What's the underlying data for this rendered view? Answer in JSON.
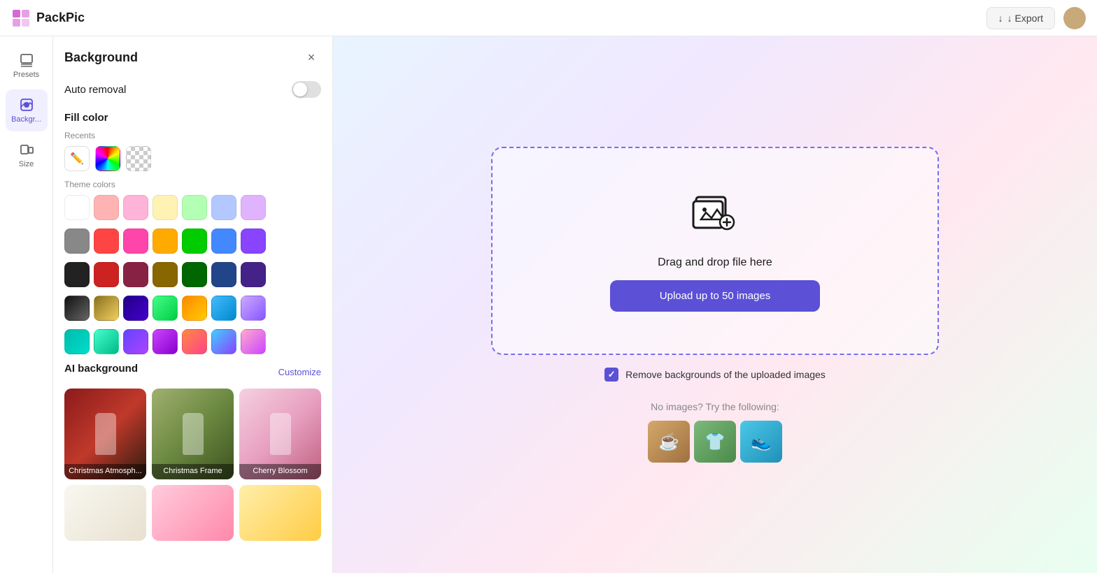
{
  "app": {
    "name": "PackPic",
    "logo_icon": "grid-icon"
  },
  "topbar": {
    "export_label": "↓ Export",
    "avatar_alt": "user-avatar"
  },
  "sidebar": {
    "items": [
      {
        "id": "presets",
        "label": "Presets",
        "icon": "layers-icon",
        "active": false
      },
      {
        "id": "background",
        "label": "Backgr...",
        "icon": "background-icon",
        "active": true
      },
      {
        "id": "size",
        "label": "Size",
        "icon": "size-icon",
        "active": false
      }
    ]
  },
  "panel": {
    "title": "Background",
    "close_label": "×",
    "auto_removal": {
      "label": "Auto removal",
      "enabled": false
    },
    "fill_color": {
      "title": "Fill color",
      "recents_label": "Recents",
      "theme_colors_label": "Theme colors",
      "recents": [
        {
          "type": "pen",
          "value": "pen"
        },
        {
          "type": "multicolor",
          "value": "multicolor"
        },
        {
          "type": "checker",
          "value": "checker"
        }
      ],
      "theme_colors_row1": [
        "#ffffff",
        "#ffb3b3",
        "#ffb3d9",
        "#fff3b3",
        "#b3ffb3",
        "#b3c8ff",
        "#e0b3ff"
      ],
      "theme_colors_row2": [
        "#888888",
        "#ff4444",
        "#ff44aa",
        "#ffaa00",
        "#00cc00",
        "#4488ff",
        "#8844ff"
      ],
      "theme_colors_row3": [
        "#222222",
        "#cc2222",
        "#882244",
        "#886600",
        "#006600",
        "#224488",
        "#442288"
      ],
      "gradient_row1": [
        {
          "type": "gradient",
          "style": "linear-gradient(135deg, #111 0%, #666 100%)"
        },
        {
          "type": "gradient",
          "style": "linear-gradient(135deg, #8b7020 0%, #f0d060 100%)"
        },
        {
          "type": "gradient",
          "style": "linear-gradient(135deg, #220088 0%, #4400cc 100%)"
        },
        {
          "type": "gradient",
          "style": "linear-gradient(135deg, #44ff88 0%, #00cc44 100%)"
        },
        {
          "type": "gradient",
          "style": "linear-gradient(135deg, #ff8800 0%, #ffcc00 100%)"
        },
        {
          "type": "gradient",
          "style": "linear-gradient(135deg, #44bbff 0%, #0088cc 100%)"
        },
        {
          "type": "gradient",
          "style": "linear-gradient(135deg, #ccaaff 0%, #8855ff 100%)"
        }
      ],
      "gradient_row2": [
        {
          "type": "gradient",
          "style": "linear-gradient(135deg, #00bbaa 0%, #00ddcc 100%)"
        },
        {
          "type": "gradient",
          "style": "linear-gradient(135deg, #44ffcc 0%, #00bb88 100%)"
        },
        {
          "type": "gradient",
          "style": "linear-gradient(135deg, #6644ff 0%, #aa44ff 100%)"
        },
        {
          "type": "gradient",
          "style": "linear-gradient(135deg, #cc44ff 0%, #8800cc 100%)"
        },
        {
          "type": "gradient",
          "style": "linear-gradient(135deg, #ff8844 0%, #ff4488 100%)"
        },
        {
          "type": "gradient",
          "style": "linear-gradient(135deg, #44ccff 0%, #8844ff 100%)"
        },
        {
          "type": "gradient",
          "style": "linear-gradient(135deg, #ffaacc 0%, #cc44ff 100%)"
        }
      ]
    },
    "ai_background": {
      "title": "AI background",
      "customize_label": "Customize",
      "cards": [
        {
          "id": "christmas-atmosphere",
          "label": "Christmas Atmosph...",
          "bg_class": "ai-card-christmas-atm"
        },
        {
          "id": "christmas-frame",
          "label": "Christmas Frame",
          "bg_class": "ai-card-christmas-frame"
        },
        {
          "id": "cherry-blossom",
          "label": "Cherry Blossom",
          "bg_class": "ai-card-cherry-blossom"
        }
      ],
      "more_cards": [
        {
          "id": "white-flowers",
          "bg_style": "linear-gradient(135deg, #f8f8f0 0%, #e8e0d0 100%)"
        },
        {
          "id": "pink-flowers",
          "bg_style": "linear-gradient(135deg, #ffccdd 0%, #ff88aa 100%)"
        },
        {
          "id": "yellow-flowers",
          "bg_style": "linear-gradient(135deg, #ffeeaa 0%, #ffcc44 100%)"
        }
      ]
    }
  },
  "canvas": {
    "drop_zone": {
      "drag_text": "Drag and drop file here",
      "upload_button_label": "Upload up to 50 images",
      "icon": "upload-images-icon"
    },
    "checkbox": {
      "checked": true,
      "label": "Remove backgrounds of the uploaded images"
    },
    "no_images": {
      "text": "No images? Try the following:",
      "suggestions": [
        {
          "id": "coffee",
          "emoji": "☕"
        },
        {
          "id": "shirt",
          "emoji": "👕"
        },
        {
          "id": "shoe",
          "emoji": "👟"
        }
      ]
    }
  }
}
